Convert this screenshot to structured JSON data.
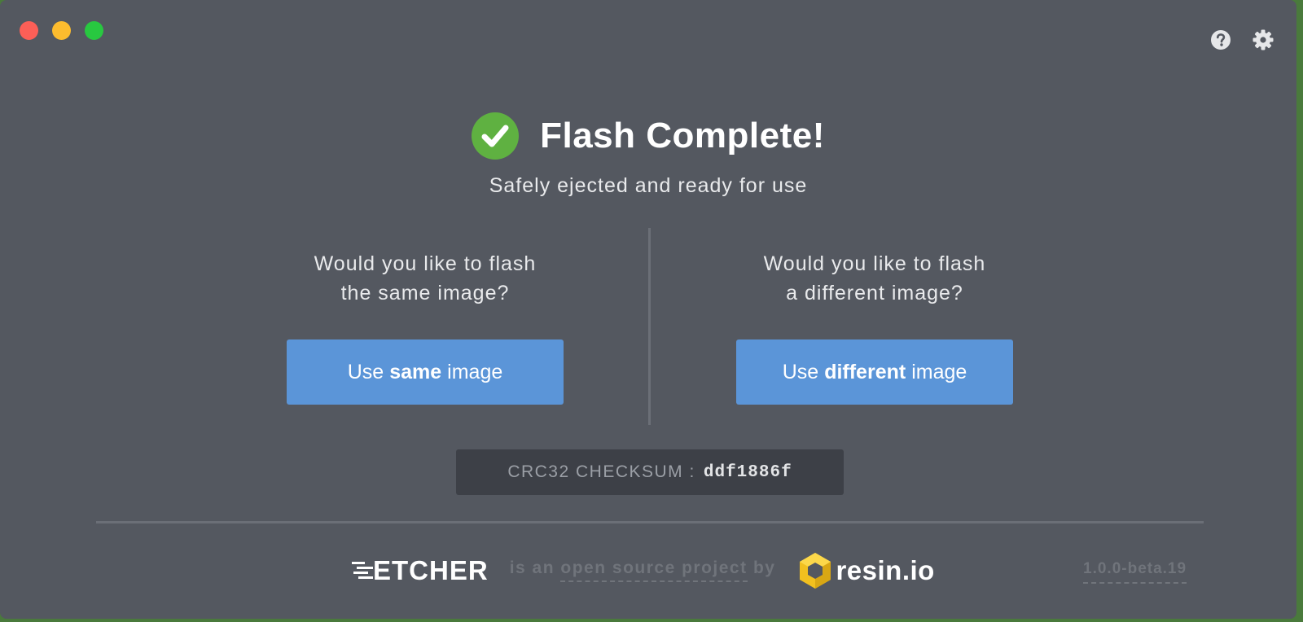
{
  "window": {
    "controls": [
      "close",
      "minimize",
      "zoom"
    ],
    "toolbar_icons": [
      "help-icon",
      "gear-icon"
    ]
  },
  "status": {
    "title": "Flash Complete!",
    "subtitle": "Safely ejected and ready for use"
  },
  "same_image": {
    "question_line1": "Would you like to flash",
    "question_line2": "the same image?",
    "button_prefix": "Use",
    "button_bold": "same",
    "button_suffix": "image"
  },
  "different_image": {
    "question_line1": "Would you like to flash",
    "question_line2": "a different image?",
    "button_prefix": "Use",
    "button_bold": "different",
    "button_suffix": "image"
  },
  "checksum": {
    "label": "CRC32 CHECKSUM :",
    "value": "ddf1886f"
  },
  "footer": {
    "brand": "ETCHER",
    "tagline_prefix": "is an",
    "tagline_link": "open source project",
    "tagline_suffix": "by",
    "company": "resin.io",
    "version": "1.0.0-beta.19"
  },
  "colors": {
    "window_bg": "#545860",
    "button": "#5b95d8",
    "success": "#5fb141",
    "checksum_bg": "#3d4047",
    "muted": "#70747b"
  }
}
